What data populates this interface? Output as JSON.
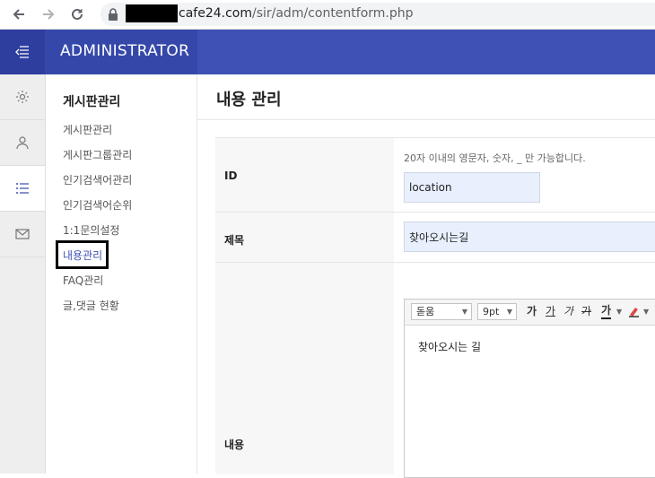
{
  "browser": {
    "url_host": "cafe24.com",
    "url_path": "/sir/adm/contentform.php"
  },
  "header": {
    "brand": "ADMINISTRATOR"
  },
  "rail": {
    "icons": [
      "gear-icon",
      "user-icon",
      "list-icon",
      "mail-icon"
    ],
    "active_index": 2
  },
  "sidemenu": {
    "title": "게시판관리",
    "items": [
      {
        "label": "게시판관리"
      },
      {
        "label": "게시판그룹관리"
      },
      {
        "label": "인기검색어관리"
      },
      {
        "label": "인기검색어순위"
      },
      {
        "label": "1:1문의설정"
      },
      {
        "label": "내용관리"
      },
      {
        "label": "FAQ관리"
      },
      {
        "label": "글,댓글 현황"
      }
    ],
    "current_index": 5
  },
  "main": {
    "title": "내용 관리",
    "form": {
      "id_label": "ID",
      "id_help": "20자 이내의 영문자, 숫자, _ 만 가능합니다.",
      "id_value": "location",
      "subject_label": "제목",
      "subject_value": "찾아오시는길",
      "content_label": "내용",
      "editor": {
        "font": "돋움",
        "size": "9pt",
        "tools": [
          "가",
          "가",
          "가",
          "가",
          "가"
        ],
        "body": "찾아오시는 길"
      }
    }
  },
  "colors": {
    "header": "#3f51b5",
    "accent": "#3f51b5",
    "input_bg": "#e8f0fe"
  }
}
